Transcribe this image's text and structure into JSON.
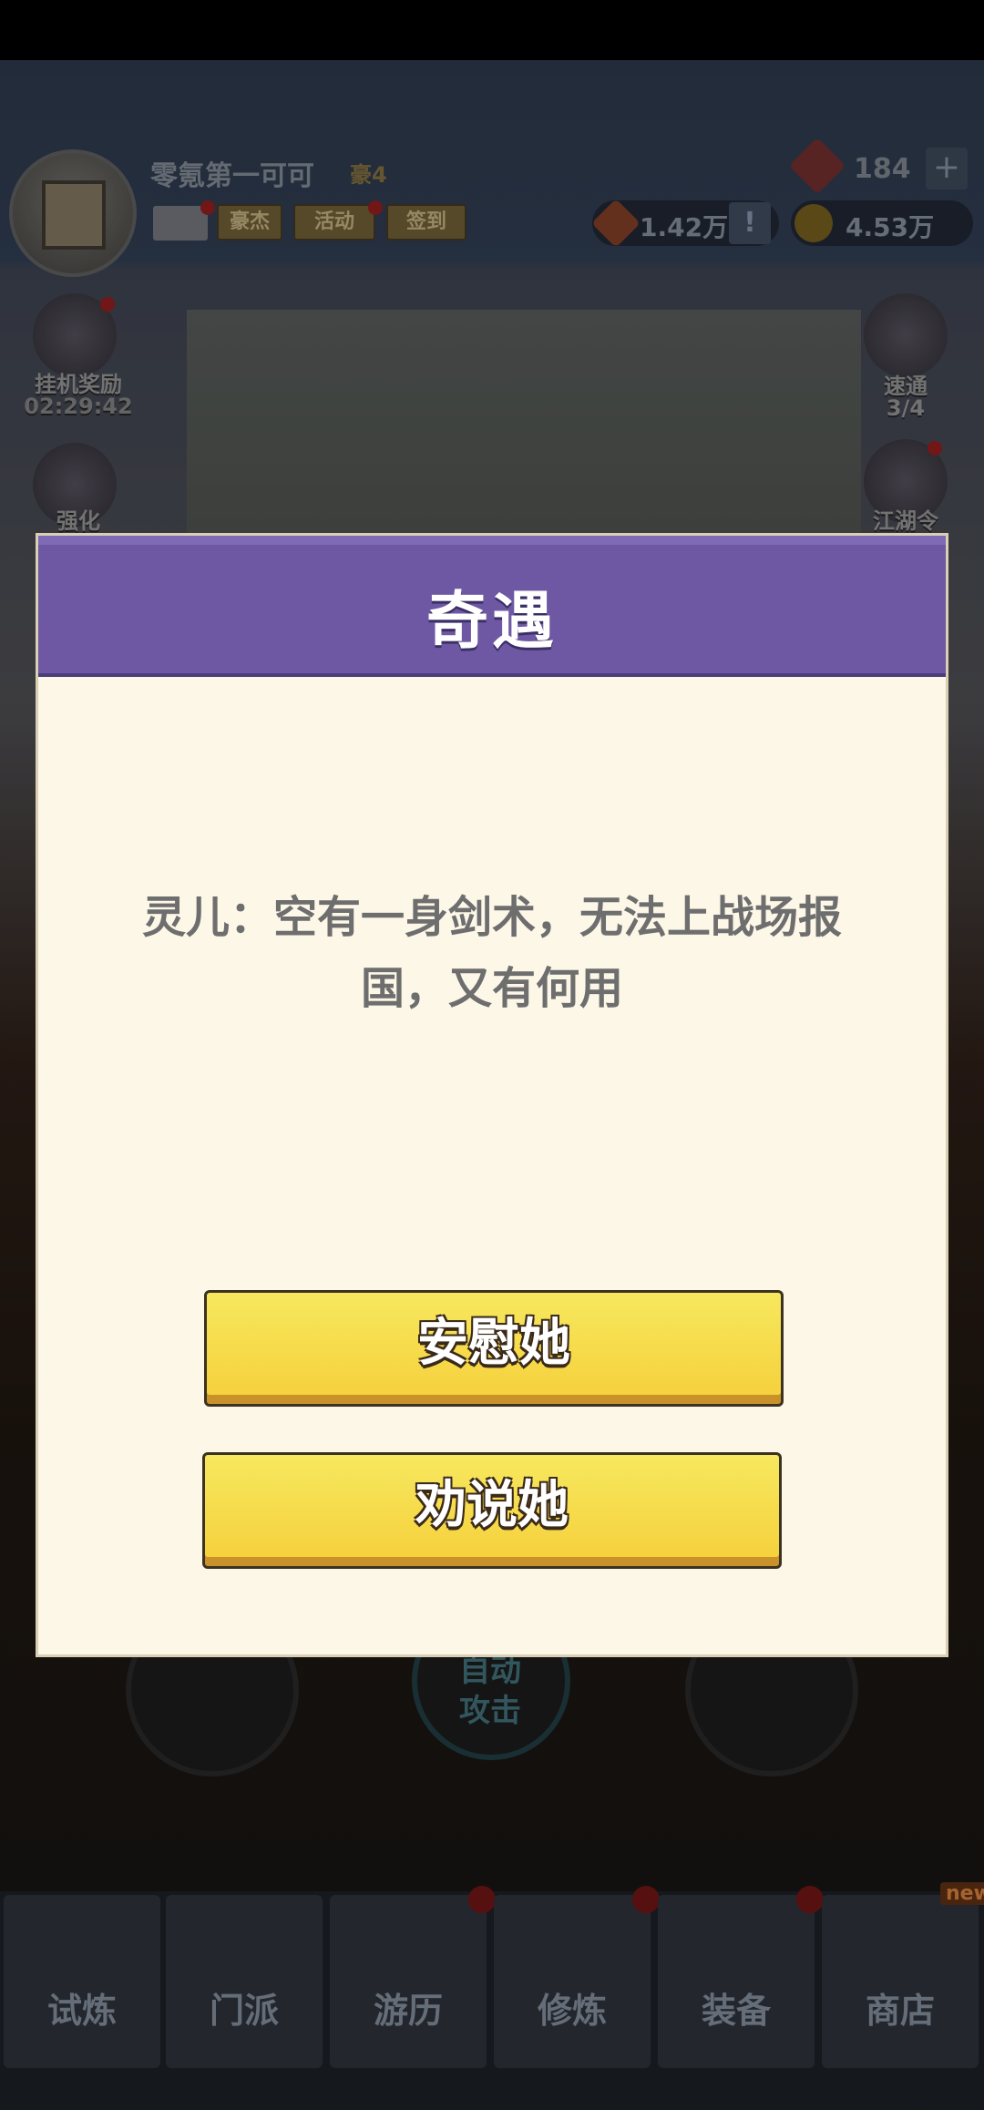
{
  "header": {
    "player_name": "零氪第一可可",
    "vip_level": "豪4",
    "buttons": [
      "豪杰",
      "活动",
      "签到"
    ],
    "gems": "184",
    "gems_plus": "+",
    "resource1": "1.42万",
    "resource1_alert": "!",
    "coins": "4.53万"
  },
  "side_left": {
    "idle_reward_label": "挂机奖励",
    "idle_timer": "02:29:42",
    "enhance_label": "强化"
  },
  "side_right": {
    "sweep_label": "速通",
    "sweep_count": "3/4",
    "token_label": "江湖令"
  },
  "controls": {
    "auto_attack_label": "自动攻击"
  },
  "bottom_nav": {
    "items": [
      "试炼",
      "门派",
      "游历",
      "修炼",
      "装备",
      "商店"
    ],
    "new_badge": "new"
  },
  "dialog": {
    "title": "奇遇",
    "message": "灵儿：空有一身剑术，无法上战场报国，又有何用",
    "choice_1": "安慰她",
    "choice_2": "劝说她"
  },
  "colors": {
    "dialog_header": "#6e58a4",
    "dialog_body": "#fdf7e8",
    "choice_button": "#f5d84a"
  }
}
